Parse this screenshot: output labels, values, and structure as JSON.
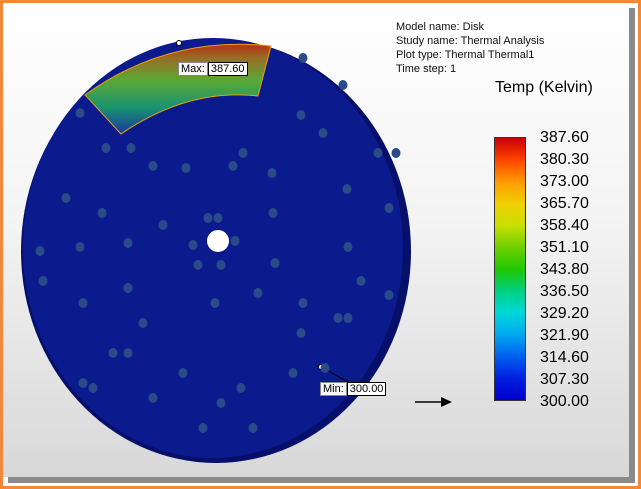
{
  "plot_info": {
    "model_name": "Model name: Disk",
    "study_name": "Study name: Thermal Analysis",
    "plot_type": "Plot type: Thermal Thermal1",
    "time_step": "Time step: 1"
  },
  "legend": {
    "title": "Temp (Kelvin)",
    "ticks": [
      "387.60",
      "380.30",
      "373.00",
      "365.70",
      "358.40",
      "351.10",
      "343.80",
      "336.50",
      "329.20",
      "321.90",
      "314.60",
      "307.30",
      "300.00"
    ],
    "colors": [
      "#cc0000",
      "#ff4400",
      "#ff9900",
      "#f0d000",
      "#c8e000",
      "#70d000",
      "#20c800",
      "#00d080",
      "#00d8d8",
      "#00a8f0",
      "#0060f0",
      "#0020e0",
      "#0000cc"
    ]
  },
  "markers": {
    "max_label": "Max:",
    "max_value": "387.60",
    "min_label": "Min:",
    "min_value": "300.00"
  },
  "colors": {
    "disk": "#0b1a8c",
    "hot": "#c83a10",
    "frame": "#f08a3a"
  }
}
